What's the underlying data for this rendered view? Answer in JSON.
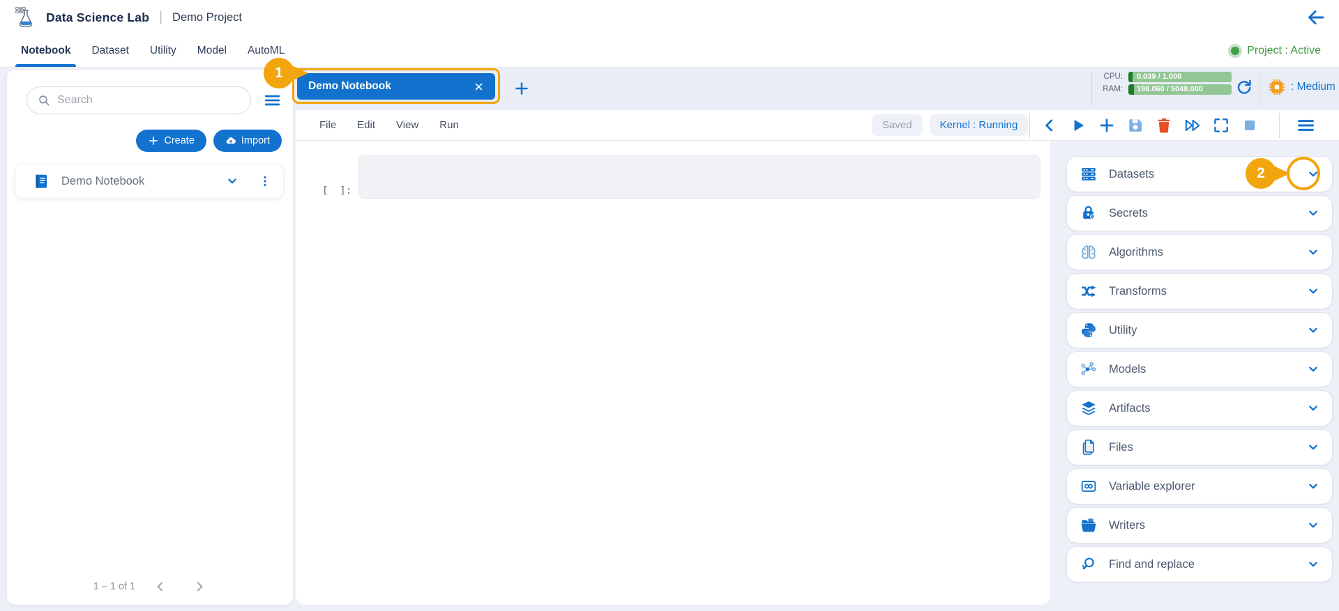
{
  "header": {
    "brand": "Data Science Lab",
    "divider": "|",
    "project": "Demo Project"
  },
  "nav": {
    "tabs": [
      {
        "label": "Notebook"
      },
      {
        "label": "Dataset"
      },
      {
        "label": "Utility"
      },
      {
        "label": "Model"
      },
      {
        "label": "AutoML"
      }
    ],
    "active_tab": "Notebook",
    "status": "Project : Active"
  },
  "left_panel": {
    "search_placeholder": "Search",
    "create_button": "Create",
    "import_button": "Import",
    "notebook_item": "Demo Notebook",
    "pagination": "1 – 1 of 1"
  },
  "workspace": {
    "tab_title": "Demo Notebook",
    "resources": {
      "cpu_label": "CPU:",
      "cpu_value": "0.039 / 1.000",
      "ram_label": "RAM:",
      "ram_value": "198.060 / 5048.000",
      "instance_label": ": Medium"
    },
    "menu": [
      "File",
      "Edit",
      "View",
      "Run"
    ],
    "save_status": "Saved",
    "kernel_status": "Kernel : Running",
    "toolbar_icons": [
      "chevron-left",
      "run-cell",
      "add-cell",
      "save",
      "delete",
      "run-all",
      "fullscreen",
      "stop"
    ],
    "cell_prompt": "[  ]:"
  },
  "right_panel": {
    "items": [
      {
        "label": "Datasets",
        "icon": "datasets"
      },
      {
        "label": "Secrets",
        "icon": "secrets"
      },
      {
        "label": "Algorithms",
        "icon": "algorithms"
      },
      {
        "label": "Transforms",
        "icon": "transforms"
      },
      {
        "label": "Utility",
        "icon": "utility"
      },
      {
        "label": "Models",
        "icon": "models"
      },
      {
        "label": "Artifacts",
        "icon": "artifacts"
      },
      {
        "label": "Files",
        "icon": "files"
      },
      {
        "label": "Variable explorer",
        "icon": "variable-explorer"
      },
      {
        "label": "Writers",
        "icon": "writers"
      },
      {
        "label": "Find and replace",
        "icon": "find-replace"
      }
    ]
  },
  "annotations": {
    "badge1": "1",
    "badge2": "2"
  },
  "colors": {
    "primary_blue": "#1372ce",
    "tab_blue": "#1171cc",
    "annotation_orange": "#f2a50c",
    "status_green": "#3c9a40",
    "meter_green": "#92c795",
    "meter_dark_green": "#1f7d2a",
    "danger_red": "#e94e25"
  }
}
